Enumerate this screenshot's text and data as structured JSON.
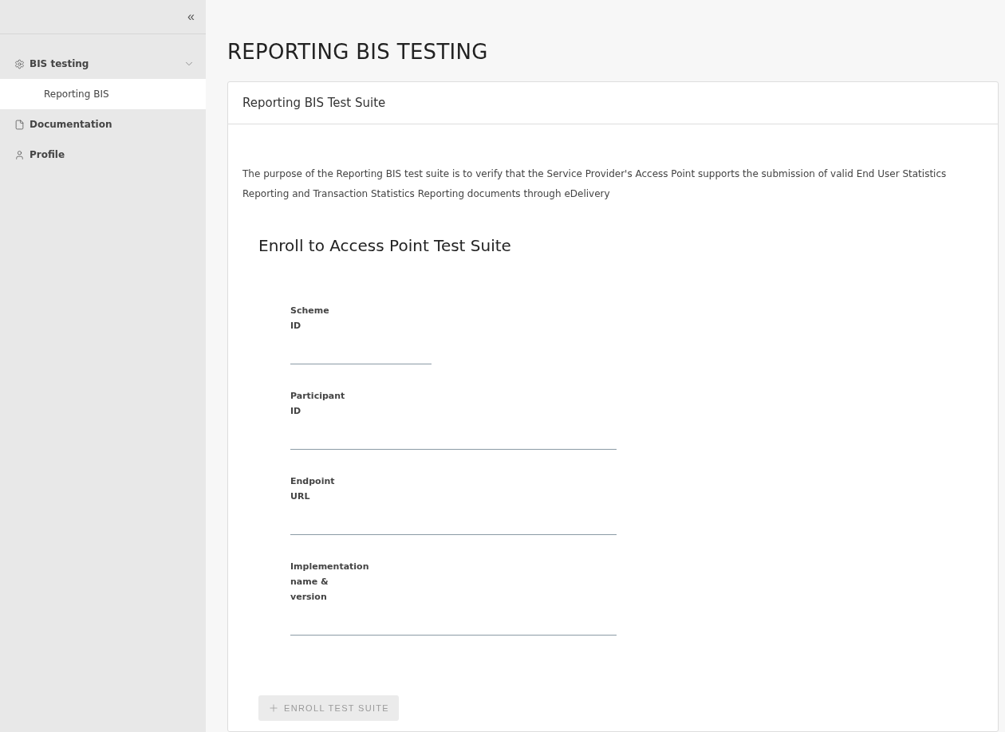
{
  "sidebar": {
    "collapse": "«",
    "items": [
      {
        "label": "BIS testing",
        "kind": "gear",
        "expanded": true,
        "selected": false,
        "children": [
          {
            "label": "Reporting BIS",
            "selected": true
          }
        ]
      },
      {
        "label": "Documentation",
        "kind": "file",
        "selected": false
      },
      {
        "label": "Profile",
        "kind": "user",
        "selected": false
      }
    ]
  },
  "page_title": "REPORTING BIS TESTING",
  "card": {
    "title": "Reporting BIS Test Suite",
    "description": "The purpose of the Reporting BIS test suite is to verify that the Service Provider's Access Point supports the submission of valid End User Statistics Reporting and Transaction Statistics Reporting documents through eDelivery",
    "form_title": "Enroll to Access Point Test Suite",
    "fields": [
      {
        "label": "Scheme\nID",
        "kind": "short"
      },
      {
        "label": "Participant\nID",
        "kind": "long"
      },
      {
        "label": "Endpoint\nURL",
        "kind": "long"
      },
      {
        "label": "Implementation\nname &\nversion",
        "kind": "long"
      }
    ],
    "button": {
      "label": "ENROLL TEST SUITE",
      "disabled": true
    }
  }
}
